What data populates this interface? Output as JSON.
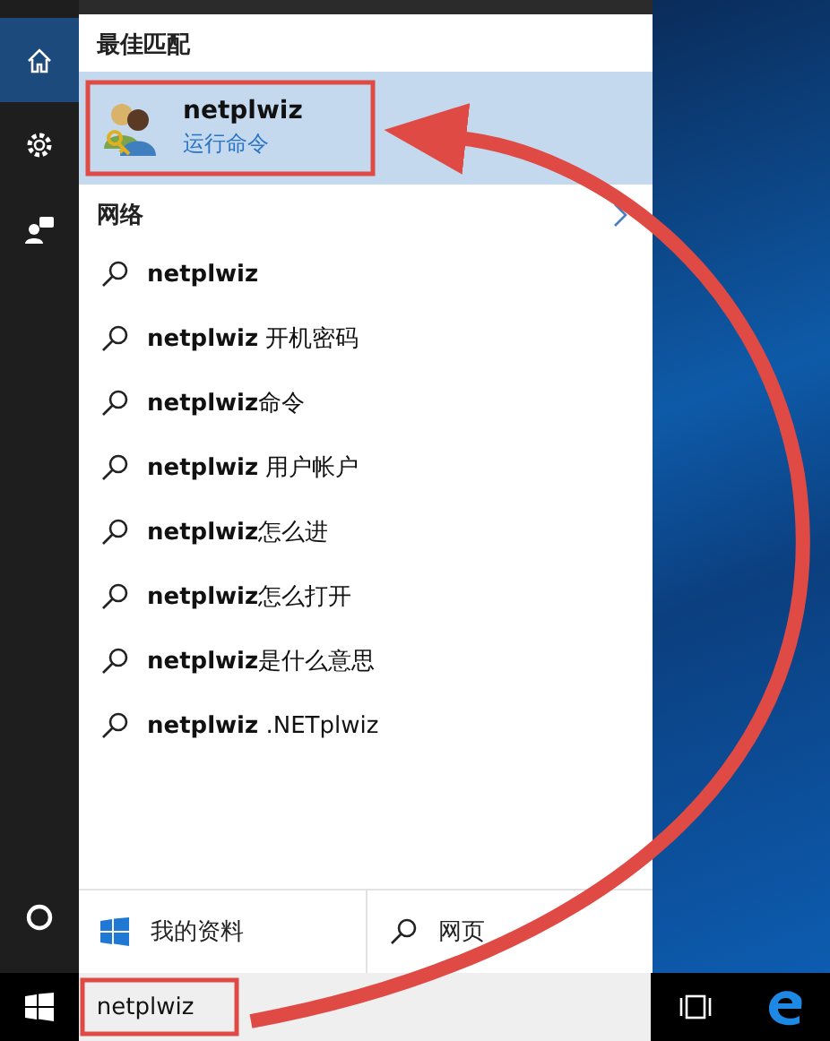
{
  "sidebar": {
    "items": [
      {
        "kind": "home",
        "selected": true
      },
      {
        "kind": "settings",
        "selected": false
      },
      {
        "kind": "feedback",
        "selected": false
      }
    ],
    "bottom": {
      "kind": "cortana"
    }
  },
  "best_match": {
    "heading": "最佳匹配",
    "item": {
      "title": "netplwiz",
      "subtitle": "运行命令",
      "selected": true
    }
  },
  "web": {
    "heading": "网络",
    "suggestions": [
      {
        "text": "**netplwiz**"
      },
      {
        "text": "**netplwiz** 开机密码"
      },
      {
        "text": "**netplwiz**命令"
      },
      {
        "text": "**netplwiz** 用户帐户"
      },
      {
        "text": "**netplwiz**怎么进"
      },
      {
        "text": "**netplwiz**怎么打开"
      },
      {
        "text": "**netplwiz**是什么意思"
      },
      {
        "text": "**netplwiz** .NETplwiz"
      }
    ]
  },
  "footer": [
    {
      "kind": "windows",
      "label": "我的资料"
    },
    {
      "kind": "search",
      "label": "网页"
    }
  ],
  "taskbar": {
    "search_value": "netplwiz"
  }
}
